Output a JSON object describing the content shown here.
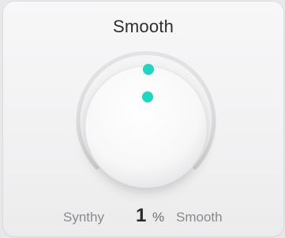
{
  "knob": {
    "title": "Smooth",
    "value": "1",
    "unit": "%",
    "left_label": "Synthy",
    "right_label": "Smooth",
    "level_fraction": 0.01,
    "accent_color": "#1fd6c3"
  }
}
